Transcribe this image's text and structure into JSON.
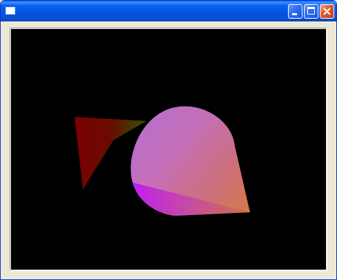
{
  "window": {
    "title": "",
    "icon": "window-icon"
  },
  "titlebar_buttons": [
    {
      "name": "minimize",
      "icon": "minimize-icon"
    },
    {
      "name": "maximize",
      "icon": "maximize-icon"
    },
    {
      "name": "close",
      "icon": "close-icon"
    }
  ],
  "scene": {
    "background": "#000000",
    "shapes": [
      {
        "name": "red-green-triangle",
        "colors": [
          "#7a0000",
          "#2e5a06"
        ]
      },
      {
        "name": "gradient-teardrop",
        "colors": [
          "#c064d0",
          "#d5744a",
          "#c021ef"
        ]
      }
    ]
  }
}
